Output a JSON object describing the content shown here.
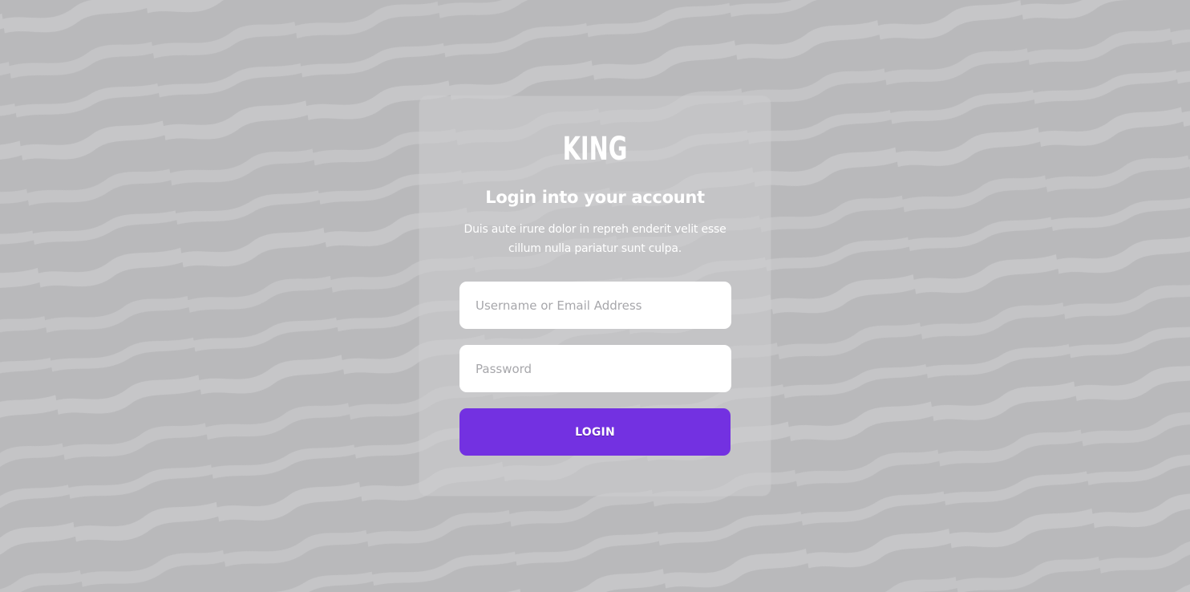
{
  "brand": {
    "logo_text": "KING"
  },
  "login": {
    "heading": "Login into your account",
    "description": "Duis aute irure dolor in repreh enderit velit esse cillum nulla pariatur sunt culpa.",
    "username_placeholder": "Username or Email Address",
    "password_placeholder": "Password",
    "username_value": "",
    "password_value": "",
    "submit_label": "LOGIN"
  },
  "colors": {
    "background": "#b9b9bb",
    "accent": "#7331e1",
    "card_text": "#ffffff"
  },
  "background_pattern": "zebra-stripes"
}
